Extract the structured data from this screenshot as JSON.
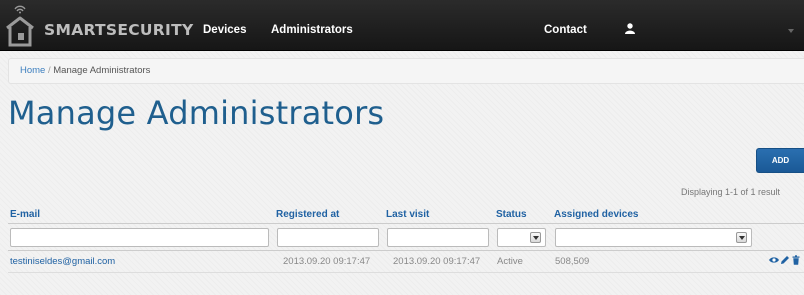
{
  "navbar": {
    "brand": "SMARTSECURITY",
    "links": [
      "Devices",
      "Administrators"
    ],
    "contact": "Contact",
    "icons": [
      "home-signal-icon",
      "user-icon",
      "caret-down-icon"
    ]
  },
  "breadcrumb": {
    "home": "Home",
    "separator": " / ",
    "current": "Manage Administrators"
  },
  "page": {
    "title": "Manage Administrators",
    "add_label": "ADD",
    "summary": "Displaying 1-1 of 1 result"
  },
  "table": {
    "headers": [
      "E-mail",
      "Registered at",
      "Last visit",
      "Status",
      "Assigned devices"
    ],
    "rows": [
      {
        "email": "testiniseldes@gmail.com",
        "registered": "2013.09.20 09:17:47",
        "last_visit": "2013.09.20 09:17:47",
        "status": "Active",
        "devices": "508,509",
        "actions": [
          "view-icon",
          "edit-icon",
          "delete-icon"
        ]
      }
    ]
  },
  "colors": {
    "navbar": "#1e1e1e",
    "link": "#2062a3",
    "title": "#1f5f8e",
    "button": "#1f63a5"
  }
}
